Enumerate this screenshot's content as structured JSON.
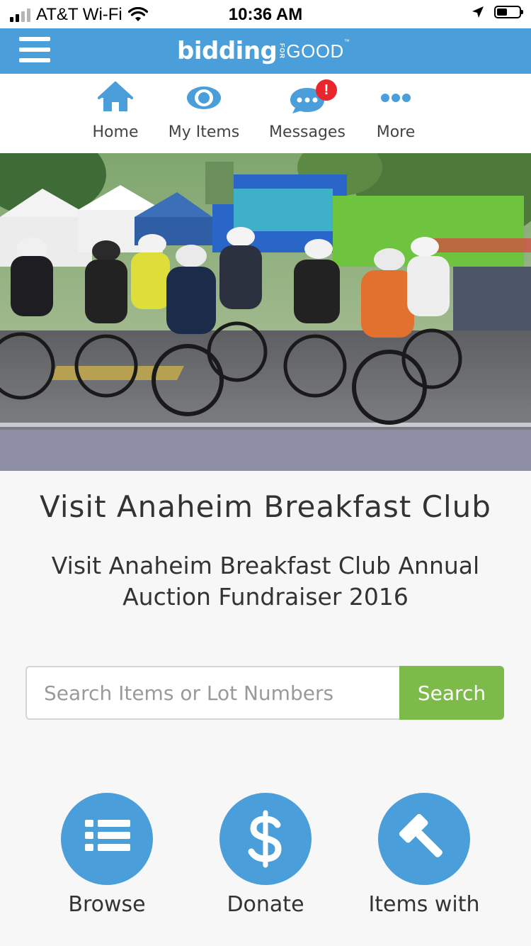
{
  "status_bar": {
    "carrier": "AT&T Wi-Fi",
    "time": "10:36 AM",
    "signal_bars_filled": 2,
    "signal_bars_total": 4,
    "battery_level": 0.45
  },
  "header": {
    "logo": {
      "main": "bidding",
      "for": "FOR",
      "good": "GOOD",
      "tm": "™"
    },
    "background_color": "#4a9ed9"
  },
  "nav": {
    "items": [
      {
        "label": "Home",
        "icon": "home-icon"
      },
      {
        "label": "My Items",
        "icon": "eye-icon"
      },
      {
        "label": "Messages",
        "icon": "chat-icon",
        "badge": "!"
      },
      {
        "label": "More",
        "icon": "more-dots-icon"
      }
    ]
  },
  "hero": {
    "alt": "cyclists racing"
  },
  "event": {
    "org_title": "Visit Anaheim Breakfast Club",
    "event_title": "Visit Anaheim Breakfast Club Annual Auction Fundraiser 2016"
  },
  "search": {
    "placeholder": "Search Items or Lot Numbers",
    "button_label": "Search",
    "button_color": "#7cbb4a"
  },
  "actions": [
    {
      "label": "Browse",
      "icon": "list-icon"
    },
    {
      "label": "Donate",
      "icon": "dollar-icon"
    },
    {
      "label": "Items with",
      "icon": "gavel-icon"
    }
  ]
}
